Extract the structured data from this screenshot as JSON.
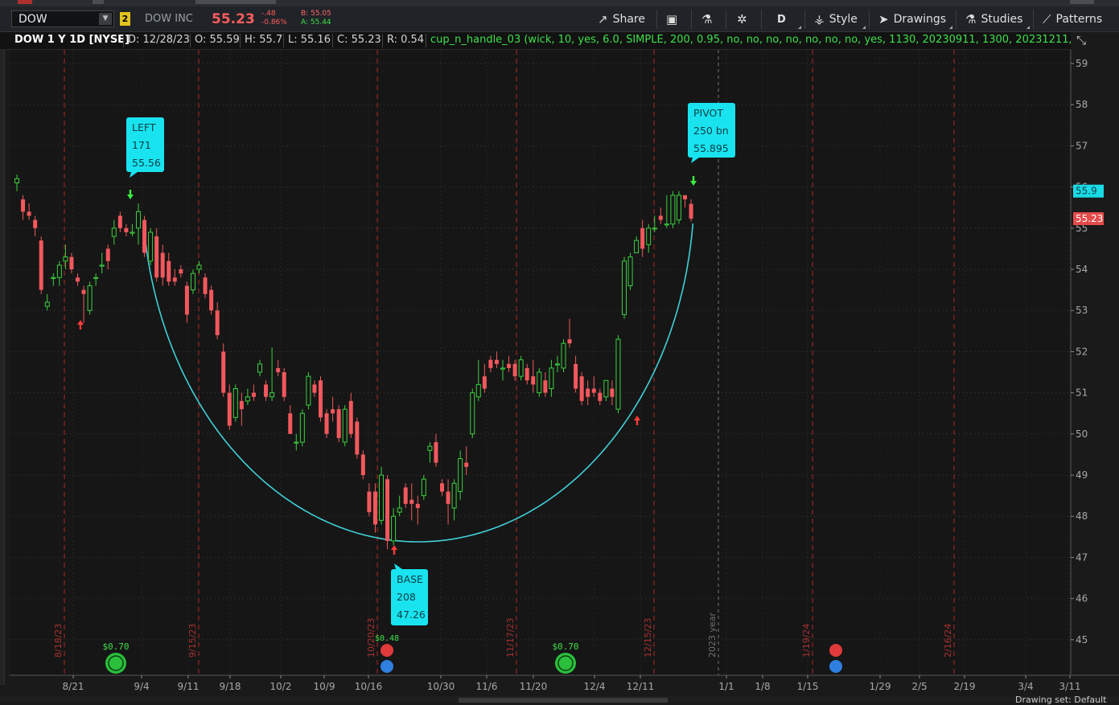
{
  "header": {
    "symbol": "DOW",
    "link_badge": "2",
    "company": "DOW INC",
    "last": "55.23",
    "change": "-.48",
    "change_pct": "-0.86%",
    "bid": "B: 55.05",
    "ask": "A: 55.44",
    "toolbar": {
      "share": "Share",
      "aggregation": "D",
      "style": "Style",
      "drawings": "Drawings",
      "studies": "Studies",
      "patterns": "Patterns"
    }
  },
  "study_bar": {
    "title": "DOW 1 Y 1D [NYSE]",
    "date": "D: 12/28/23",
    "open": "O: 55.59",
    "high": "H: 55.7",
    "low": "L: 55.16",
    "close": "C: 55.23",
    "range": "R: 0.54",
    "study": "cup_n_handle_03 (wick, 10, yes, 6.0, SIMPLE, 200, 0.95, no, no, no, no, no, no, no, yes, 1130, 20230911, 1300, 20231211,..."
  },
  "colors": {
    "up": "#3bd13f",
    "down": "#f2585d",
    "cup": "#40d0d8",
    "callout": "#19e3ef",
    "marker_red": "#ff3b3b",
    "marker_green": "#3bf13f",
    "price_label_current": "#e34b4b",
    "price_label_pivot": "#19dbe6"
  },
  "chart_data": {
    "type": "candlestick",
    "yaxis": {
      "min": 44,
      "max": 59,
      "ticks": [
        45,
        46,
        47,
        48,
        49,
        50,
        51,
        52,
        53,
        54,
        55,
        56,
        57,
        58,
        59
      ]
    },
    "xaxis_labels": [
      "8/21",
      "9/4",
      "9/11",
      "9/18",
      "10/2",
      "10/9",
      "10/16",
      "10/30",
      "11/6",
      "11/20",
      "12/4",
      "12/11",
      "1/1",
      "1/8",
      "1/15",
      "1/29",
      "2/5",
      "2/19",
      "3/4",
      "3/11"
    ],
    "period_labels": [
      "8/18/23",
      "9/15/23",
      "10/20/23",
      "11/17/23",
      "12/15/23",
      "1/19/24",
      "2/16/24"
    ],
    "year_label": "2023 year",
    "candles": [
      [
        56.1,
        56.3,
        55.9,
        56.2
      ],
      [
        55.7,
        55.8,
        55.2,
        55.4
      ],
      [
        55.4,
        55.6,
        55.2,
        55.3
      ],
      [
        55.2,
        55.3,
        54.8,
        55.0
      ],
      [
        54.7,
        54.8,
        53.4,
        53.5
      ],
      [
        53.1,
        53.4,
        53.0,
        53.2
      ],
      [
        53.8,
        53.9,
        53.6,
        53.8
      ],
      [
        53.8,
        54.2,
        53.6,
        54.1
      ],
      [
        54.2,
        54.6,
        54.0,
        54.3
      ],
      [
        54.3,
        54.4,
        53.9,
        54.0
      ],
      [
        53.8,
        53.9,
        53.6,
        53.7
      ],
      [
        53.5,
        53.6,
        52.7,
        53.4
      ],
      [
        53.0,
        53.7,
        52.9,
        53.6
      ],
      [
        53.8,
        53.9,
        53.6,
        53.8
      ],
      [
        54.1,
        54.4,
        53.9,
        54.1
      ],
      [
        54.5,
        54.6,
        54.0,
        54.2
      ],
      [
        54.8,
        55.2,
        54.6,
        55.0
      ],
      [
        55.3,
        55.4,
        54.9,
        55.0
      ],
      [
        55.0,
        55.1,
        54.8,
        54.9
      ],
      [
        54.9,
        55.1,
        54.8,
        54.9
      ],
      [
        55.0,
        55.6,
        54.6,
        55.4
      ],
      [
        55.2,
        55.3,
        54.3,
        54.4
      ],
      [
        54.2,
        55.0,
        54.1,
        54.9
      ],
      [
        54.8,
        55.0,
        53.7,
        53.8
      ],
      [
        54.4,
        54.6,
        53.6,
        53.8
      ],
      [
        54.2,
        54.4,
        53.6,
        53.7
      ],
      [
        53.8,
        54.0,
        53.6,
        53.7
      ],
      [
        54.0,
        54.1,
        53.8,
        53.9
      ],
      [
        53.6,
        53.7,
        52.7,
        52.9
      ],
      [
        53.5,
        54.0,
        53.4,
        53.9
      ],
      [
        54.0,
        54.2,
        53.9,
        54.1
      ],
      [
        53.8,
        53.9,
        53.3,
        53.4
      ],
      [
        53.5,
        53.6,
        52.9,
        53.0
      ],
      [
        53.0,
        53.2,
        52.3,
        52.4
      ],
      [
        52.0,
        52.2,
        50.9,
        51.0
      ],
      [
        51.0,
        51.2,
        50.1,
        50.2
      ],
      [
        50.4,
        51.2,
        50.3,
        51.1
      ],
      [
        50.8,
        51.0,
        50.2,
        50.6
      ],
      [
        50.8,
        51.1,
        50.7,
        50.9
      ],
      [
        51.0,
        51.2,
        50.8,
        50.9
      ],
      [
        51.5,
        51.8,
        51.4,
        51.7
      ],
      [
        51.2,
        51.3,
        50.8,
        50.9
      ],
      [
        50.9,
        52.1,
        50.8,
        51.0
      ],
      [
        51.6,
        51.8,
        51.4,
        51.5
      ],
      [
        51.5,
        51.6,
        50.8,
        50.9
      ],
      [
        50.5,
        50.7,
        50.0,
        50.0
      ],
      [
        49.8,
        50.0,
        49.6,
        49.8
      ],
      [
        49.8,
        50.6,
        49.7,
        50.5
      ],
      [
        50.7,
        51.5,
        50.6,
        51.4
      ],
      [
        51.2,
        51.3,
        50.9,
        51.0
      ],
      [
        51.3,
        51.4,
        50.3,
        50.4
      ],
      [
        50.5,
        50.6,
        49.9,
        50.0
      ],
      [
        50.6,
        50.9,
        50.3,
        50.5
      ],
      [
        50.6,
        50.7,
        49.8,
        49.9
      ],
      [
        49.8,
        50.7,
        49.7,
        50.6
      ],
      [
        50.8,
        51.0,
        49.9,
        50.0
      ],
      [
        50.3,
        50.4,
        49.4,
        49.5
      ],
      [
        49.5,
        49.6,
        48.9,
        49.0
      ],
      [
        48.6,
        48.8,
        48.0,
        48.1
      ],
      [
        48.6,
        48.8,
        47.6,
        47.8
      ],
      [
        47.9,
        49.2,
        47.8,
        49.0
      ],
      [
        48.9,
        49.0,
        47.2,
        47.4
      ],
      [
        47.4,
        48.2,
        47.3,
        48.0
      ],
      [
        48.1,
        48.5,
        48.0,
        48.2
      ],
      [
        48.7,
        48.8,
        48.2,
        48.3
      ],
      [
        48.4,
        48.8,
        47.9,
        48.3
      ],
      [
        48.3,
        48.5,
        47.8,
        48.2
      ],
      [
        48.5,
        49.0,
        48.4,
        48.9
      ],
      [
        49.6,
        49.8,
        49.3,
        49.7
      ],
      [
        49.8,
        50.0,
        49.2,
        49.3
      ],
      [
        48.8,
        48.9,
        48.5,
        48.6
      ],
      [
        48.6,
        48.9,
        47.8,
        48.3
      ],
      [
        48.2,
        48.9,
        47.9,
        48.8
      ],
      [
        48.6,
        49.6,
        48.4,
        49.4
      ],
      [
        49.3,
        49.7,
        49.0,
        49.2
      ],
      [
        50.0,
        51.1,
        49.9,
        51.0
      ],
      [
        50.9,
        51.8,
        50.8,
        51.2
      ],
      [
        51.4,
        51.7,
        51.0,
        51.1
      ],
      [
        51.8,
        51.9,
        51.5,
        51.6
      ],
      [
        51.8,
        52.0,
        51.6,
        51.7
      ],
      [
        51.6,
        51.8,
        51.3,
        51.6
      ],
      [
        51.7,
        51.9,
        51.5,
        51.6
      ],
      [
        51.7,
        51.8,
        51.3,
        51.4
      ],
      [
        51.4,
        51.9,
        51.3,
        51.8
      ],
      [
        51.6,
        51.7,
        51.2,
        51.3
      ],
      [
        51.4,
        51.8,
        51.0,
        51.2
      ],
      [
        51.0,
        51.6,
        50.9,
        51.5
      ],
      [
        51.3,
        51.5,
        50.9,
        51.0
      ],
      [
        51.1,
        51.8,
        50.9,
        51.6
      ],
      [
        51.7,
        51.9,
        51.5,
        51.7
      ],
      [
        51.6,
        52.3,
        51.5,
        52.2
      ],
      [
        52.3,
        52.8,
        52.1,
        52.2
      ],
      [
        51.7,
        51.9,
        51.0,
        51.1
      ],
      [
        51.4,
        51.5,
        50.7,
        50.8
      ],
      [
        51.1,
        51.3,
        50.7,
        50.9
      ],
      [
        51.1,
        51.4,
        50.9,
        51.0
      ],
      [
        51.0,
        51.1,
        50.7,
        50.8
      ],
      [
        50.9,
        51.2,
        50.8,
        51.3
      ],
      [
        51.1,
        51.3,
        50.7,
        50.9
      ],
      [
        50.6,
        52.4,
        50.5,
        52.3
      ],
      [
        52.9,
        54.3,
        52.8,
        54.2
      ],
      [
        53.6,
        54.4,
        53.5,
        54.3
      ],
      [
        54.4,
        54.8,
        54.4,
        54.7
      ],
      [
        55.0,
        55.2,
        54.3,
        54.5
      ],
      [
        54.6,
        55.1,
        54.4,
        55.0
      ],
      [
        55.0,
        55.3,
        54.9,
        55.0
      ],
      [
        55.3,
        55.5,
        55.1,
        55.2
      ],
      [
        55.1,
        55.8,
        55.0,
        55.1
      ],
      [
        55.1,
        55.9,
        55.0,
        55.8
      ],
      [
        55.2,
        55.9,
        55.1,
        55.8
      ],
      [
        55.8,
        55.8,
        55.5,
        55.7
      ],
      [
        55.59,
        55.7,
        55.16,
        55.23
      ]
    ],
    "callouts": [
      {
        "title": "LEFT",
        "bar": "171",
        "price": "55.56"
      },
      {
        "title": "BASE",
        "bar": "208",
        "price": "47.26"
      },
      {
        "title": "PIVOT",
        "bar": "250 bn",
        "price": "55.895"
      }
    ],
    "price_labels": [
      "55.9",
      "55.23"
    ],
    "events": [
      {
        "type": "dividend",
        "label": "$0.70"
      },
      {
        "type": "dividend",
        "label": "$0.48"
      },
      {
        "type": "dividend",
        "label": "$0.70"
      }
    ]
  },
  "bottom_text": "Drawing set: Default"
}
